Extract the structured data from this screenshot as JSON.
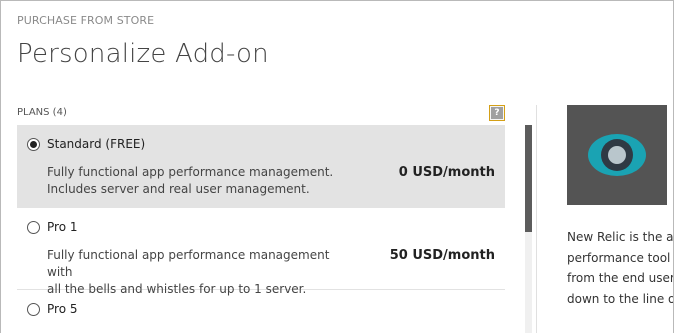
{
  "header": {
    "supertitle": "PURCHASE FROM STORE",
    "title": "Personalize Add-on"
  },
  "plans": {
    "header": "PLANS (4)",
    "items": [
      {
        "name": "Standard (FREE)",
        "desc_line1": "Fully functional app performance management.",
        "desc_line2": "Includes server and real user management.",
        "price": "0 USD/month",
        "selected": true
      },
      {
        "name": "Pro 1",
        "desc_line1": "Fully functional app performance management with",
        "desc_line2": "all the bells and whistles for up to 1 server.",
        "price": "50 USD/month",
        "selected": false
      },
      {
        "name": "Pro 5",
        "selected": false
      }
    ]
  },
  "sidebar": {
    "logo_icon": "new-relic-logo-icon",
    "desc_lines": [
      "New Relic is the al",
      "performance tool f",
      "from the end user",
      "down to the line of"
    ]
  },
  "colors": {
    "selected_row": "#e3e3e3",
    "logo_tile": "#545454",
    "logo_ring": "#1aa3b3",
    "help_border": "#d4a017"
  }
}
